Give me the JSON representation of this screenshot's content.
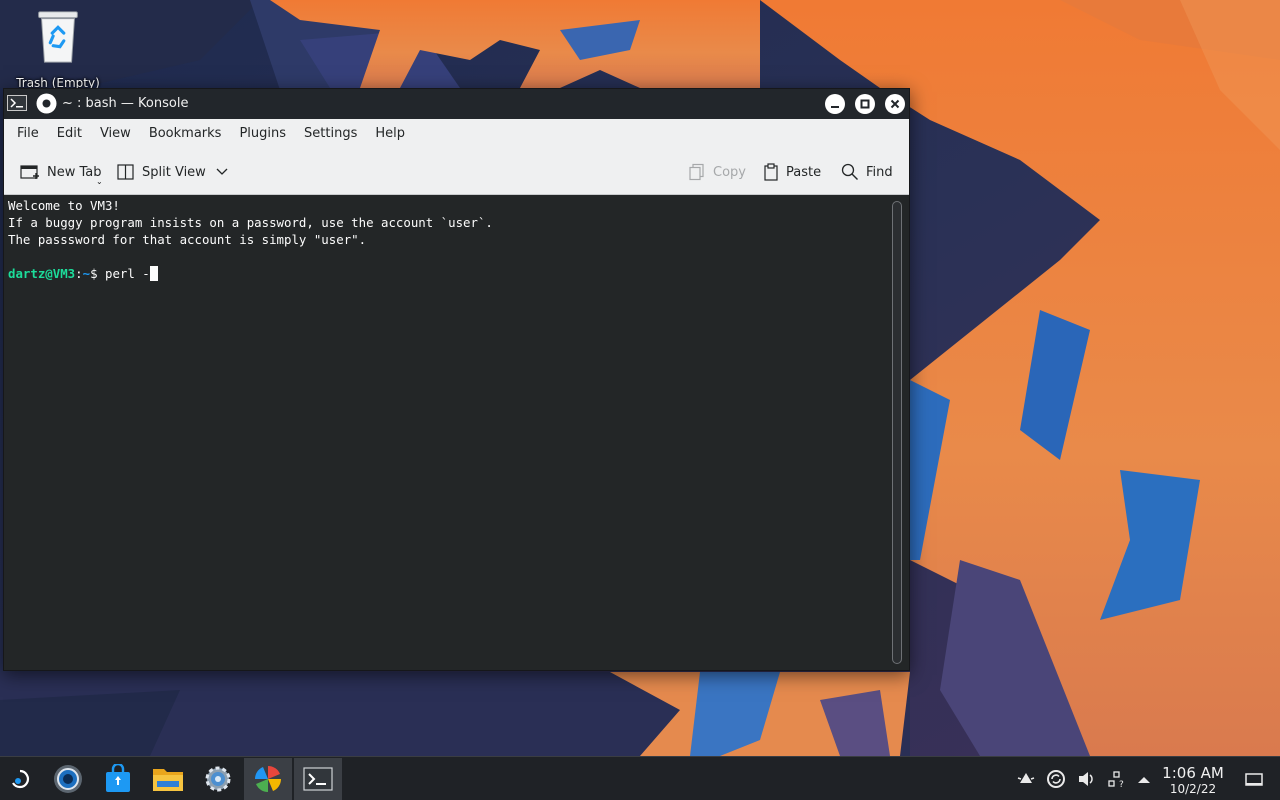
{
  "desktop": {
    "trash_label": "Trash (Empty)"
  },
  "window": {
    "title": "~ : bash — Konsole",
    "menu": [
      "File",
      "Edit",
      "View",
      "Bookmarks",
      "Plugins",
      "Settings",
      "Help"
    ],
    "toolbar": {
      "new_tab": "New Tab",
      "split_view": "Split View",
      "copy": "Copy",
      "paste": "Paste",
      "find": "Find"
    }
  },
  "terminal": {
    "lines": [
      "Welcome to VM3!",
      "If a buggy program insists on a password, use the account `user`.",
      "The passsword for that account is simply \"user\"."
    ],
    "prompt": {
      "user_host": "dartz@VM3",
      "colon": ":",
      "path": "~",
      "symbol": "$ ",
      "command": "perl -"
    }
  },
  "taskbar": {
    "apps": [
      "app-launcher",
      "discover",
      "store",
      "file-manager",
      "system-settings",
      "pinwheel-app",
      "konsole"
    ],
    "clock": {
      "time": "1:06 AM",
      "date": "10/2/22"
    }
  },
  "colors": {
    "prompt_user": "#1cdc9a",
    "prompt_path": "#1d99f3",
    "terminal_bg": "#232627",
    "titlebar_bg": "#22262b"
  }
}
